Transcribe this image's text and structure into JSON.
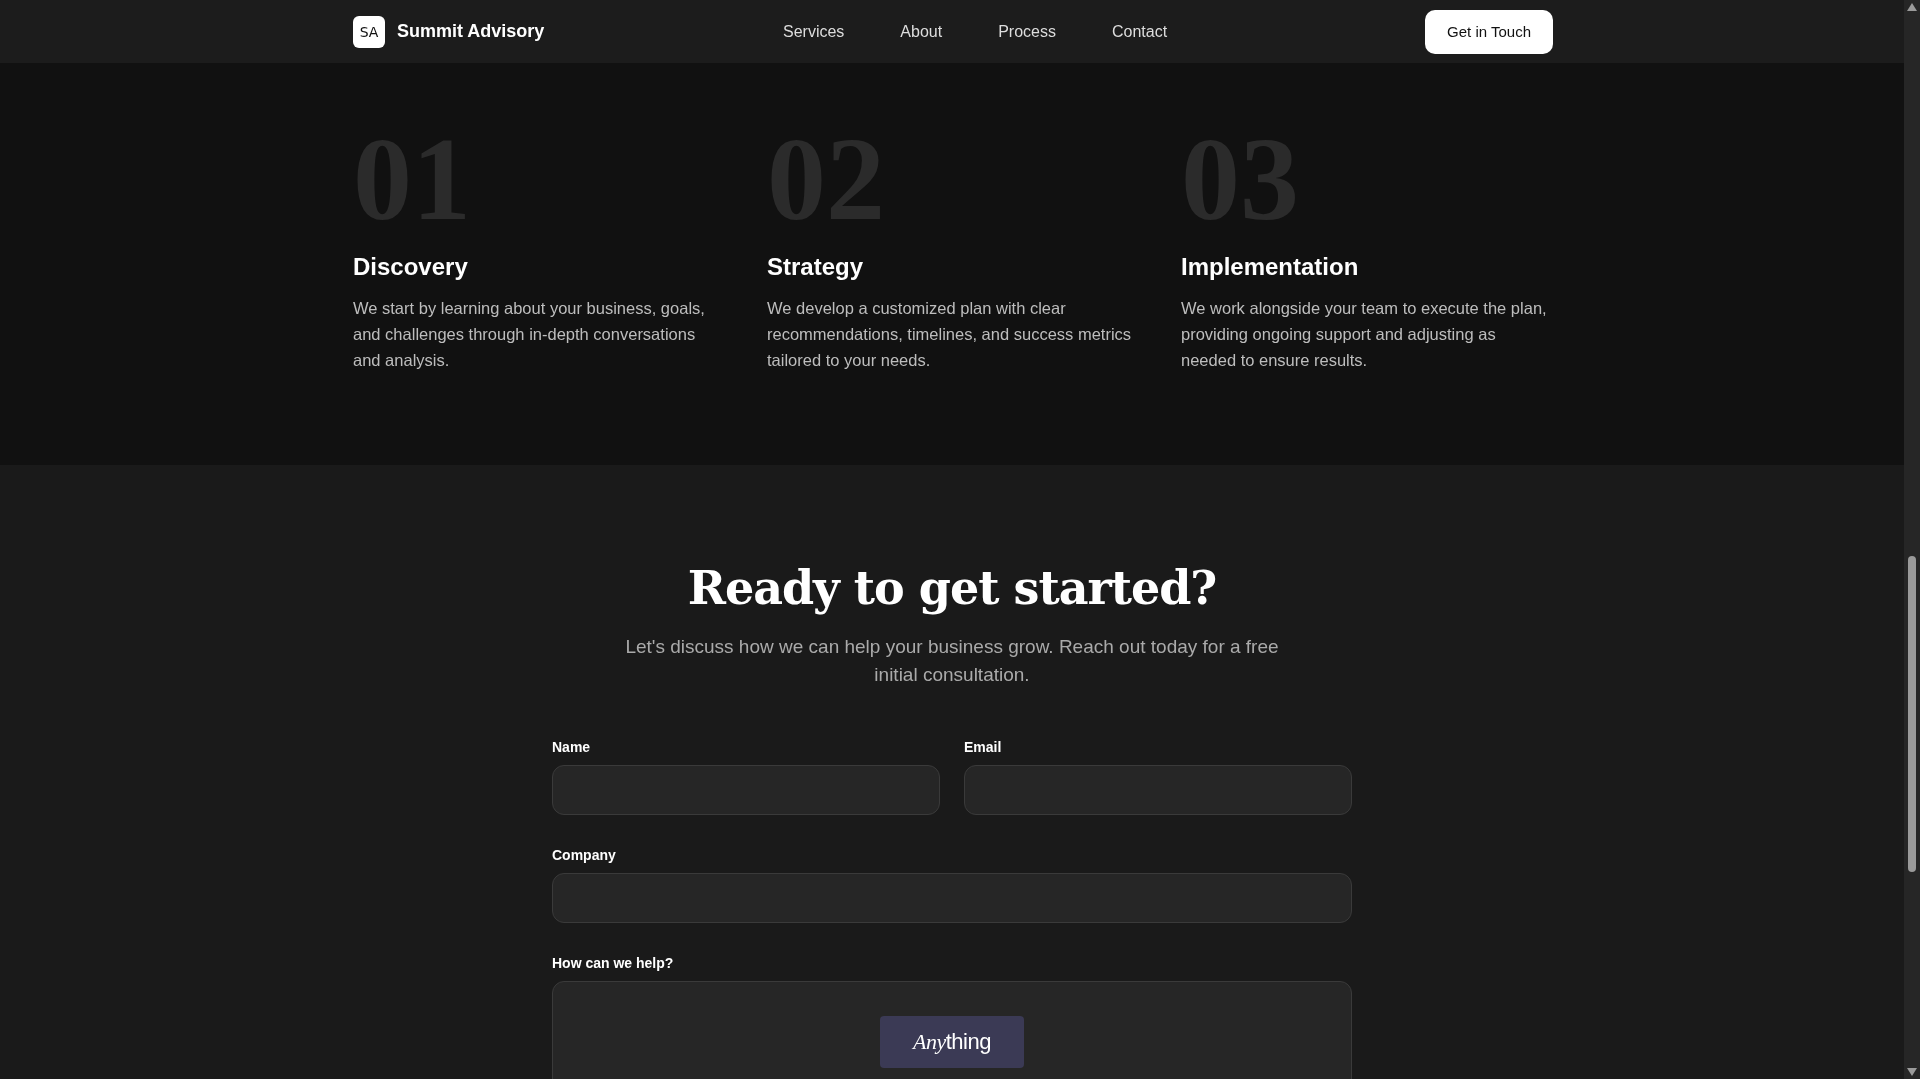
{
  "nav": {
    "logo_mark": "SA",
    "brand": "Summit Advisory",
    "links": [
      "Services",
      "About",
      "Process",
      "Contact"
    ],
    "cta": "Get in Touch"
  },
  "steps": [
    {
      "number": "01",
      "title": "Discovery",
      "text": "We start by learning about your business, goals, and challenges through in-depth conversations and analysis."
    },
    {
      "number": "02",
      "title": "Strategy",
      "text": "We develop a customized plan with clear recommendations, timelines, and success metrics tailored to your needs."
    },
    {
      "number": "03",
      "title": "Implementation",
      "text": "We work alongside your team to execute the plan, providing ongoing support and adjusting as needed to ensure results."
    }
  ],
  "contact": {
    "heading": "Ready to get started?",
    "subtitle": "Let's discuss how we can help your business grow. Reach out today for a free initial consultation.",
    "form_rows": [
      [
        {
          "label": "Name",
          "kind": "input"
        },
        {
          "label": "Email",
          "kind": "input"
        }
      ],
      [
        {
          "label": "Company",
          "kind": "input"
        }
      ],
      [
        {
          "label": "How can we help?",
          "kind": "textarea"
        }
      ]
    ],
    "badge": {
      "italic": "Any",
      "rest": "thing"
    }
  }
}
